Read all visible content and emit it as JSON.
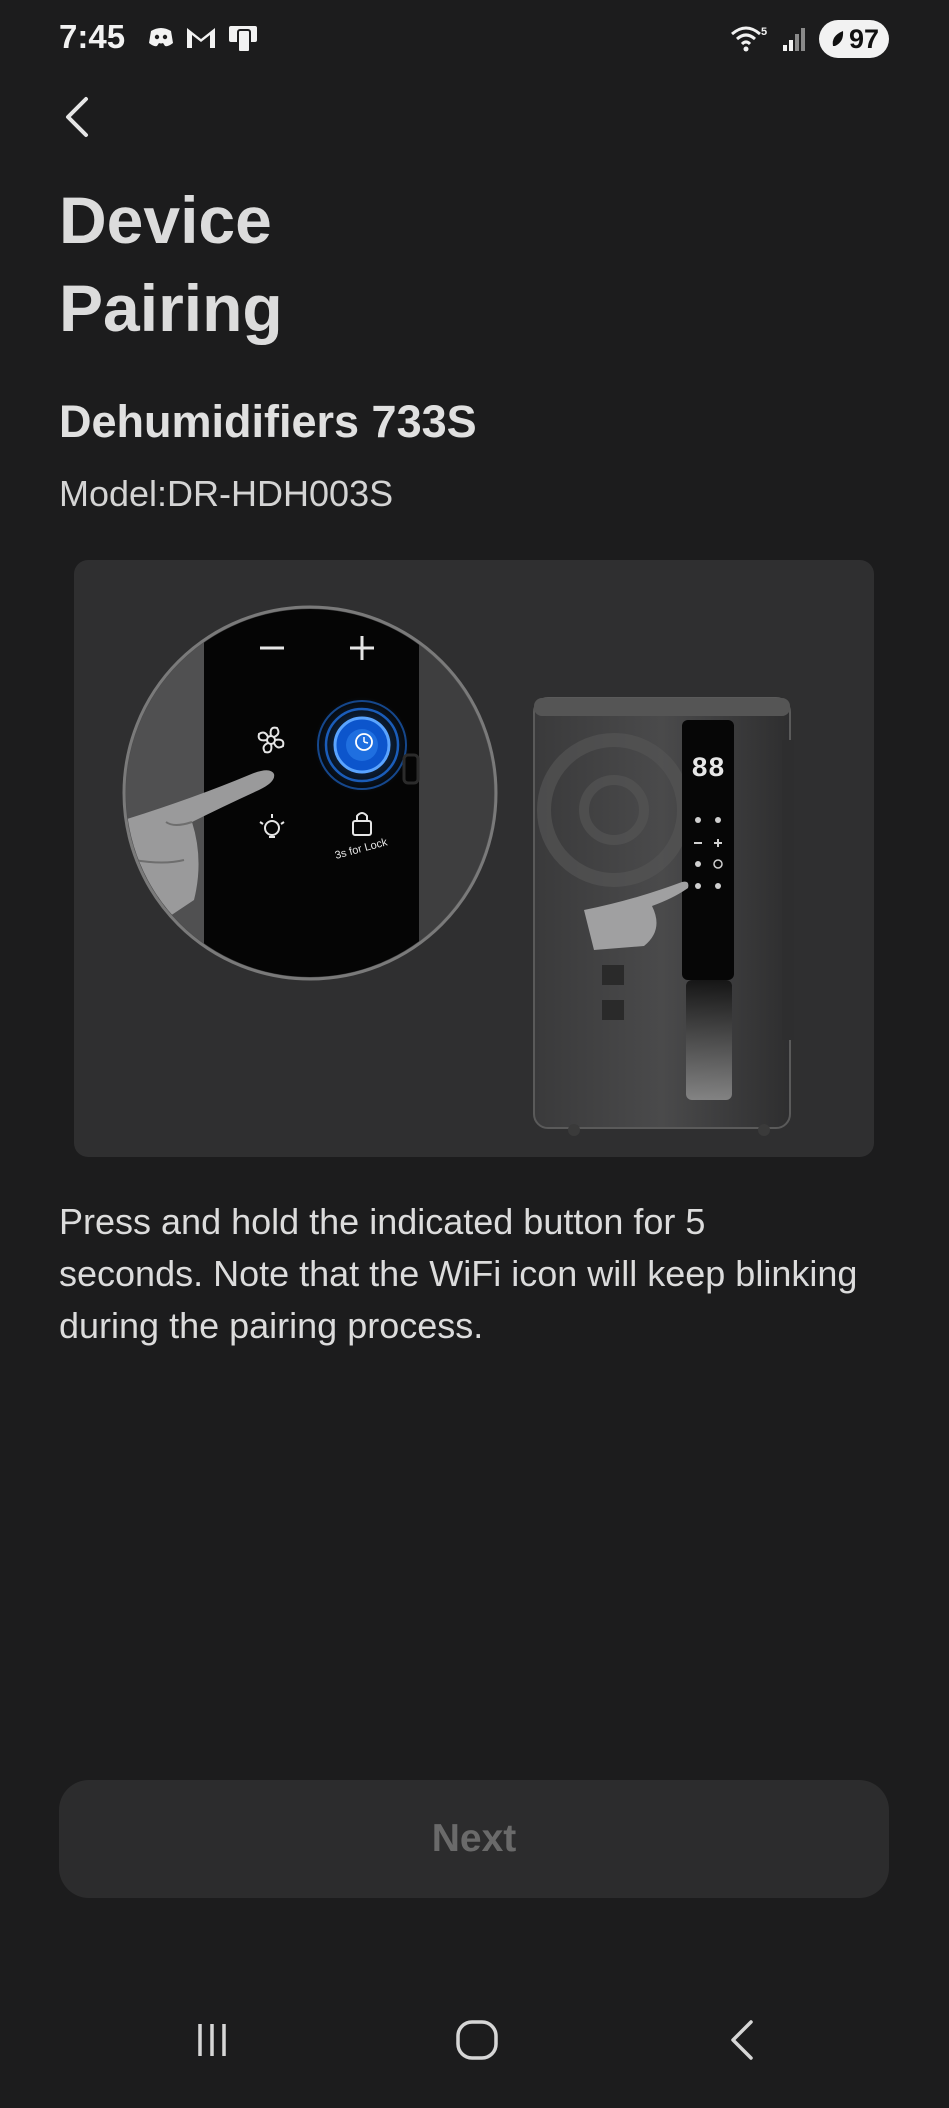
{
  "status_bar": {
    "time": "7:45",
    "battery": "97",
    "left_icons": [
      "discord-icon",
      "gmail-icon",
      "tablet-icon"
    ],
    "right_icons": [
      "wifi-icon",
      "signal-icon",
      "battery-icon"
    ],
    "wifi_badge": "5"
  },
  "header": {
    "back_icon": "chevron-left-icon",
    "title_line1": "Device",
    "title_line2": "Pairing"
  },
  "device": {
    "name": "Dehumidifiers 733S",
    "model": "Model:DR-HDH003S"
  },
  "illustration": {
    "display_digits": "88",
    "lock_caption": "3s for Lock"
  },
  "instruction": "Press and hold the indicated button for 5 seconds. Note that the WiFi icon will keep blinking during the pairing process.",
  "next_button": {
    "label": "Next"
  },
  "navigation": {
    "items": [
      "recent-apps-icon",
      "home-icon",
      "back-icon"
    ]
  },
  "colors": {
    "background": "#1c1c1d",
    "card": "#2f2f30",
    "accent": "#1f6fe0",
    "button_bg": "#2c2c2d",
    "button_text": "#6a6a6a"
  }
}
